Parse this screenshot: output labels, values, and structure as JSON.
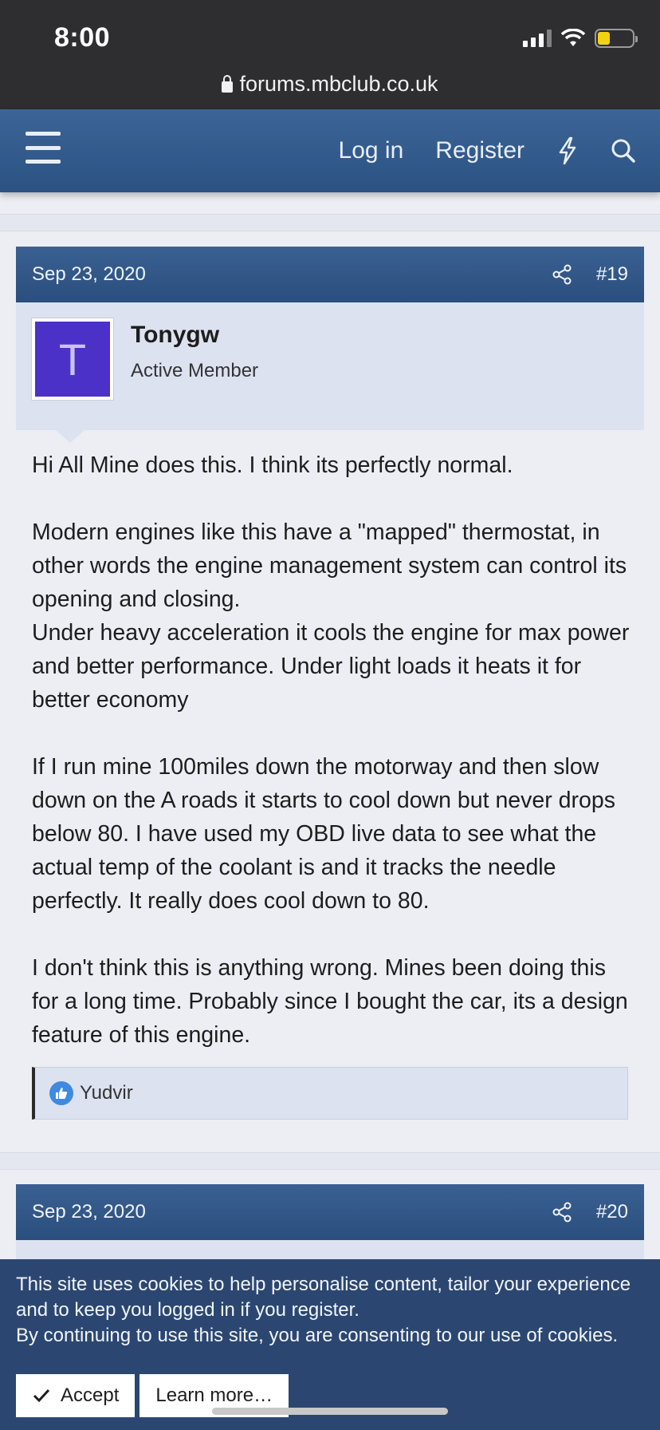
{
  "status_bar": {
    "time": "8:00",
    "url": "forums.mbclub.co.uk"
  },
  "nav": {
    "login_label": "Log in",
    "register_label": "Register"
  },
  "posts": [
    {
      "date": "Sep 23, 2020",
      "number": "#19",
      "author": {
        "initial": "T",
        "name": "Tonygw",
        "title": "Active Member",
        "avatar_color": "#4b31c8"
      },
      "paragraphs": [
        "Hi All Mine does this. I think its perfectly normal.",
        "Modern engines like this have a \"mapped\" thermostat, in other words the engine management system can control its opening and closing.\nUnder heavy acceleration it cools the engine for max power and better performance. Under light loads it heats it for better economy",
        "If I run mine 100miles down the motorway and then slow down on the A roads it starts to cool down but never drops below 80. I have used my OBD live data to see what the actual temp of the coolant is and it tracks the needle perfectly. It really does cool down to 80.",
        "I don't think this is anything wrong. Mines been doing this for a long time. Probably since I bought the car, its a design feature of this engine."
      ],
      "reactions": {
        "icon": "like-icon",
        "names": "Yudvir"
      }
    },
    {
      "date": "Sep 23, 2020",
      "number": "#20"
    }
  ],
  "cookie_notice": {
    "text_line1": "This site uses cookies to help personalise content, tailor your experience and to keep you logged in if you register.",
    "text_line2": "By continuing to use this site, you are consenting to our use of cookies.",
    "accept_label": "Accept",
    "learn_more_label": "Learn more…"
  },
  "colors": {
    "nav_bg": "#2b5283",
    "cookie_bg": "#2b4771",
    "user_bg": "#dde2f1",
    "like": "#3f8ae0"
  }
}
